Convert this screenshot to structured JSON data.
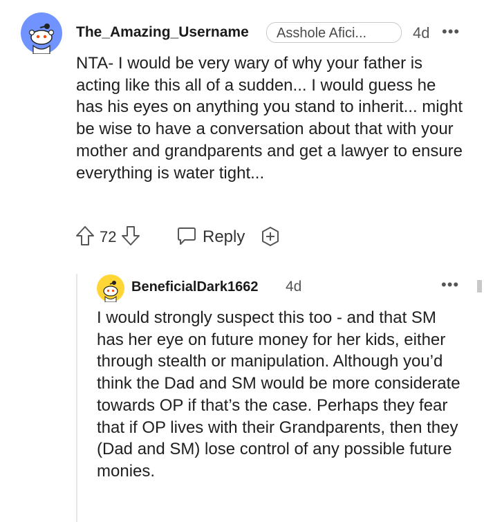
{
  "comment": {
    "username": "The_Amazing_Username",
    "flair": "Asshole Afici...",
    "time": "4d",
    "more_label": "•••",
    "text": "NTA- I would be very wary of why your father is acting like this all of a sudden... I would guess he has his eyes on anything you stand to inherit... might be wise to have a conversation about that with your mother and grandparents and get a lawyer to ensure everything is water tight...",
    "score": "72",
    "reply_label": "Reply",
    "avatar_color": "#7193ff"
  },
  "reply": {
    "username": "BeneficialDark1662",
    "time": "4d",
    "more_label": "•••",
    "text": "I would strongly suspect this too - and that SM has her eye on future money for her kids, either through stealth or manipulation. Although you’d think the Dad and SM would be more considerate towards OP if that’s the case. Perhaps they fear that if OP lives with their Grandparents, then they (Dad and SM) lose control of any possible future monies.",
    "avatar_color": "#ffd635"
  }
}
